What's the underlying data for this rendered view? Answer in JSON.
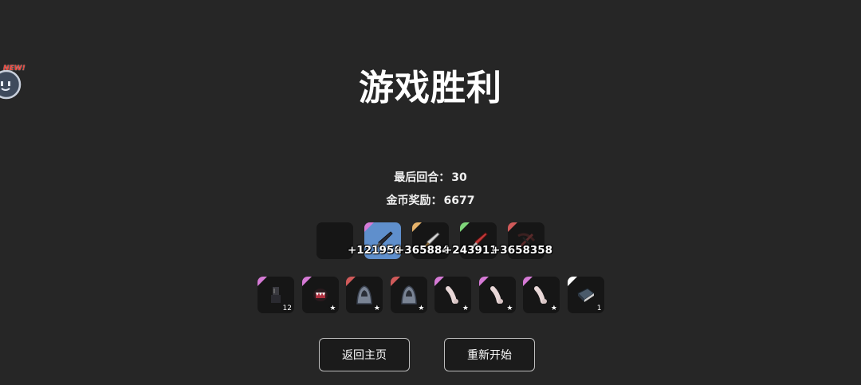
{
  "title": "游戏胜利",
  "stats": {
    "last_round_label": "最后回合：",
    "last_round_value": "30",
    "gold_label": "金币奖励：",
    "gold_value": "6677"
  },
  "mascot": {
    "badge": "NEW!"
  },
  "weapons": [
    {
      "icon": "empty-slot",
      "rarity_color": null,
      "damage": ""
    },
    {
      "icon": "dark-sword-icon",
      "rarity_color": "#d67ad6",
      "damage": "+121956"
    },
    {
      "icon": "silver-dagger-icon",
      "rarity_color": "#e6b26a",
      "damage": "+365884"
    },
    {
      "icon": "red-blade-icon",
      "rarity_color": "#7fd67a",
      "damage": "+243911"
    },
    {
      "icon": "crossbow-icon",
      "rarity_color": "#d05a5a",
      "damage": "+3658358"
    }
  ],
  "items": [
    {
      "icon": "gauntlet-icon",
      "rarity_color": "#d67ad6",
      "badge": "12"
    },
    {
      "icon": "fang-mask-icon",
      "rarity_color": "#d67ad6",
      "badge": "★"
    },
    {
      "icon": "hooded-cloak-icon",
      "rarity_color": "#d05a5a",
      "badge": "★"
    },
    {
      "icon": "hooded-cloak-icon",
      "rarity_color": "#d05a5a",
      "badge": "★"
    },
    {
      "icon": "bone-icon",
      "rarity_color": "#d67ad6",
      "badge": "★"
    },
    {
      "icon": "bone-icon",
      "rarity_color": "#d67ad6",
      "badge": "★"
    },
    {
      "icon": "bone-icon",
      "rarity_color": "#d67ad6",
      "badge": "★"
    },
    {
      "icon": "book-icon",
      "rarity_color": "#ffffff",
      "badge": "1"
    }
  ],
  "buttons": {
    "home": "返回主页",
    "restart": "重新开始"
  }
}
